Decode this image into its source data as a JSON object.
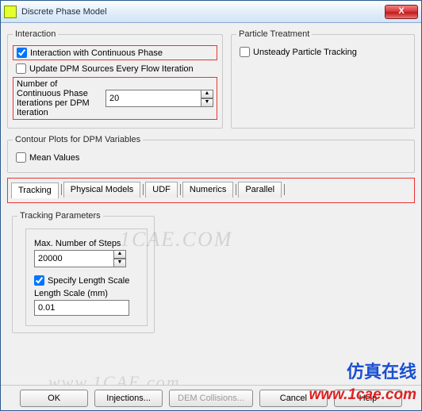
{
  "window": {
    "title": "Discrete Phase Model",
    "close": "X"
  },
  "interaction": {
    "legend": "Interaction",
    "chk_continuous": "Interaction with Continuous Phase",
    "chk_update_dpm": "Update DPM Sources Every Flow Iteration",
    "num_continuous_label_a": "Number of Continuous Phase",
    "num_continuous_label_b": "Iterations per DPM Iteration",
    "num_continuous_value": "20"
  },
  "particle": {
    "legend": "Particle Treatment",
    "chk_unsteady": "Unsteady Particle Tracking"
  },
  "contour": {
    "legend": "Contour Plots for DPM Variables",
    "chk_mean": "Mean Values"
  },
  "tabs": {
    "t0": "Tracking",
    "t1": "Physical Models",
    "t2": "UDF",
    "t3": "Numerics",
    "t4": "Parallel"
  },
  "tracking": {
    "legend": "Tracking Parameters",
    "max_steps_label": "Max. Number of Steps",
    "max_steps_value": "20000",
    "chk_specify": "Specify Length Scale",
    "length_label": "Length Scale (mm)",
    "length_value": "0.01"
  },
  "buttons": {
    "ok": "OK",
    "injections": "Injections...",
    "dem": "DEM Collisions...",
    "cancel": "Cancel",
    "help": "Help"
  },
  "watermarks": {
    "w1": "1CAE.COM",
    "w2": "www.1CAE.com",
    "brand_cn": "仿真在线",
    "brand_url": "www.1cae.com"
  }
}
